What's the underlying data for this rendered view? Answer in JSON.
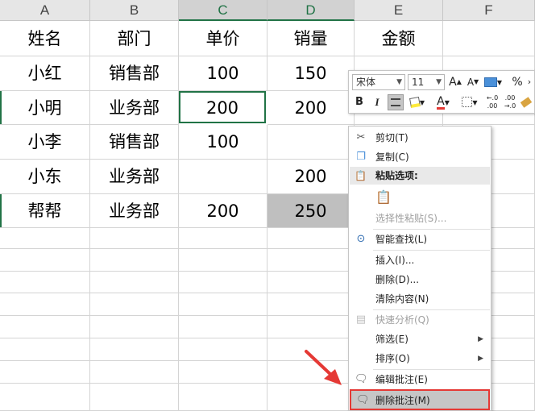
{
  "columns": [
    "A",
    "B",
    "C",
    "D",
    "E",
    "F"
  ],
  "rows": [
    [
      "姓名",
      "部门",
      "单价",
      "销量",
      "金额",
      ""
    ],
    [
      "小红",
      "销售部",
      "100",
      "150",
      "",
      ""
    ],
    [
      "小明",
      "业务部",
      "200",
      "200",
      "",
      ""
    ],
    [
      "小李",
      "销售部",
      "100",
      "",
      "",
      ""
    ],
    [
      "小东",
      "业务部",
      "",
      "200",
      "",
      ""
    ],
    [
      "帮帮",
      "业务部",
      "200",
      "250",
      "",
      ""
    ]
  ],
  "minibar": {
    "font_name": "宋体",
    "font_size": "11",
    "grow_icon": "A",
    "shrink_icon": "A",
    "percent": "%",
    "bold": "B",
    "italic": "I",
    "font_color_glyph": "A"
  },
  "menu": {
    "cut": "剪切(T)",
    "copy": "复制(C)",
    "paste_options": "粘贴选项:",
    "paste_special": "选择性粘贴(S)...",
    "smart_lookup": "智能查找(L)",
    "insert": "插入(I)...",
    "delete": "删除(D)...",
    "clear": "清除内容(N)",
    "quick_analysis": "快速分析(Q)",
    "filter": "筛选(E)",
    "sort": "排序(O)",
    "edit_comment": "编辑批注(E)",
    "delete_comment": "删除批注(M)"
  },
  "colors": {
    "accent": "#217346",
    "highlight": "#e53935"
  }
}
